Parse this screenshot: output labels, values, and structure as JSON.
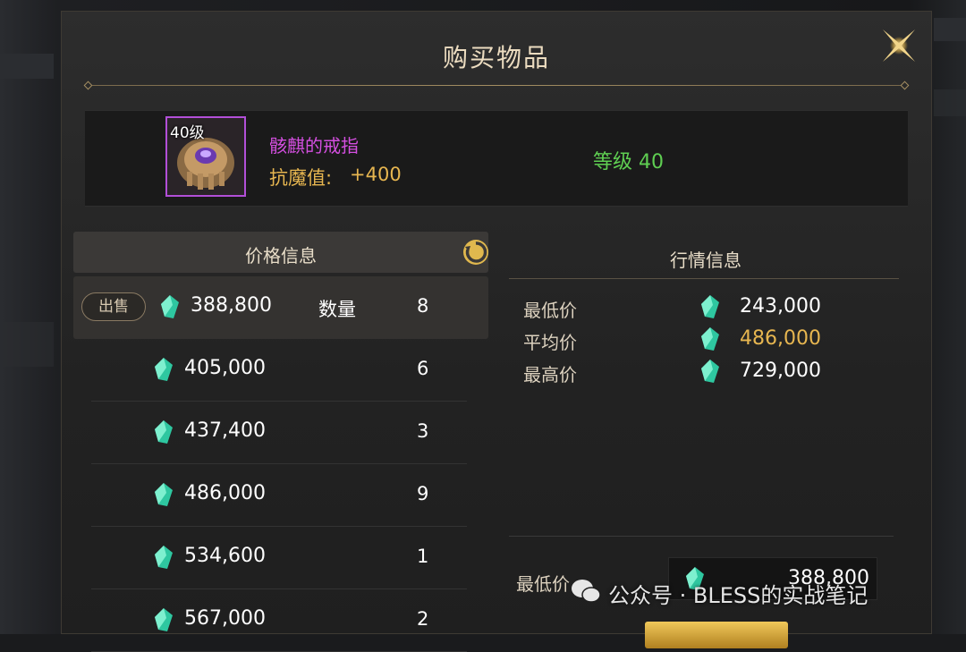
{
  "dialog": {
    "title": "购买物品"
  },
  "item": {
    "level_badge": "40级",
    "name": "骸麒的戒指",
    "stat_label": "抗魔值:",
    "stat_value": "+400",
    "grade": "等级 40",
    "frame_color": "#b24fd8"
  },
  "price_info": {
    "header": "价格信息",
    "sell_button": "出售",
    "quantity_label": "数量",
    "rows": [
      {
        "price": "388,800",
        "qty": "8"
      },
      {
        "price": "405,000",
        "qty": "6"
      },
      {
        "price": "437,400",
        "qty": "3"
      },
      {
        "price": "486,000",
        "qty": "9"
      },
      {
        "price": "534,600",
        "qty": "1"
      },
      {
        "price": "567,000",
        "qty": "2"
      }
    ]
  },
  "market_info": {
    "header": "行情信息",
    "rows": [
      {
        "label": "最低价",
        "value": "243,000",
        "color": "#ffffff"
      },
      {
        "label": "平均价",
        "value": "486,000",
        "color": "#e7b650"
      },
      {
        "label": "最高价",
        "value": "729,000",
        "color": "#ffffff"
      }
    ],
    "lowest_label": "最低价",
    "lowest_value": "388,800"
  },
  "icons": {
    "currency": "teal-gem-icon",
    "refresh": "refresh-icon",
    "close": "close-x-icon"
  },
  "watermark": {
    "text": "公众号 · BLESS的实战笔记"
  }
}
